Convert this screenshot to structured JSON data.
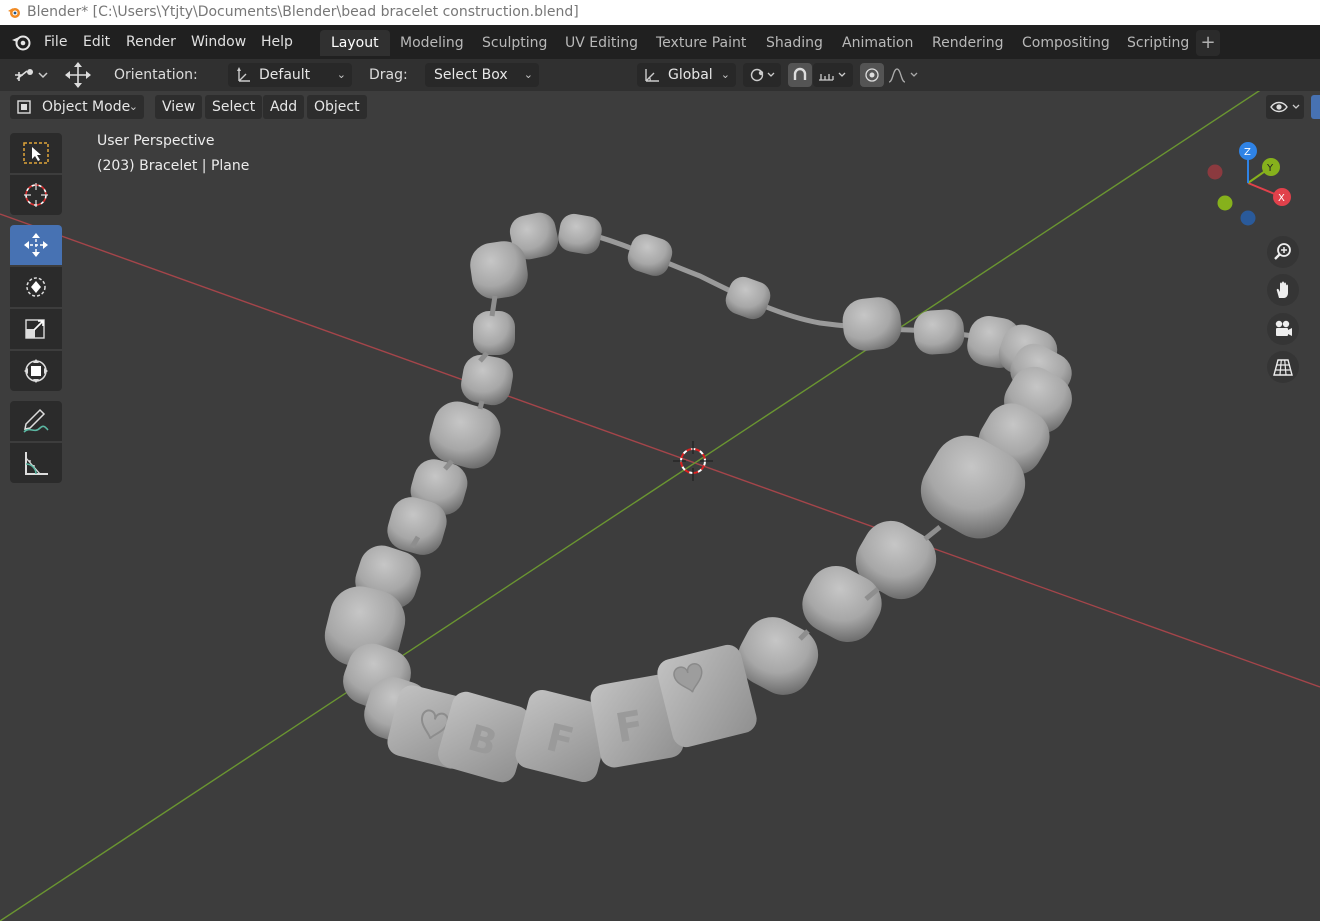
{
  "window": {
    "title": "Blender* [C:\\Users\\Ytjty\\Documents\\Blender\\bead bracelet construction.blend]"
  },
  "menubar": {
    "items": [
      "File",
      "Edit",
      "Render",
      "Window",
      "Help"
    ]
  },
  "workspaces": {
    "tabs": [
      "Layout",
      "Modeling",
      "Sculpting",
      "UV Editing",
      "Texture Paint",
      "Shading",
      "Animation",
      "Rendering",
      "Compositing",
      "Scripting"
    ],
    "active": "Layout",
    "add_label": "+"
  },
  "tool_header": {
    "orientation_label": "Orientation:",
    "orientation_value": "Default",
    "drag_label": "Drag:",
    "drag_value": "Select Box",
    "transform_orientation": "Global"
  },
  "viewport_header": {
    "mode": "Object Mode",
    "menus": [
      "View",
      "Select",
      "Add",
      "Object"
    ]
  },
  "viewport": {
    "view_name": "User Perspective",
    "object_info": "(203) Bracelet | Plane"
  },
  "gizmo": {
    "x_label": "X",
    "y_label": "Y",
    "z_label": "Z",
    "x_color": "#e1414b",
    "y_color": "#86b11c",
    "z_color": "#2f83e6"
  },
  "tools": [
    "select-box-tool",
    "cursor-tool",
    "move-tool",
    "rotate-tool",
    "scale-tool",
    "transform-tool",
    "annotate-tool",
    "measure-tool"
  ],
  "active_tool": "move-tool",
  "nav_buttons": [
    "zoom-icon",
    "hand-pan-icon",
    "camera-icon",
    "grid-ortho-icon"
  ],
  "colors": {
    "accent": "#4772b3",
    "x_axis": "#b54a4f",
    "y_axis": "#6e9a34",
    "bead": "#a8a8a8"
  }
}
